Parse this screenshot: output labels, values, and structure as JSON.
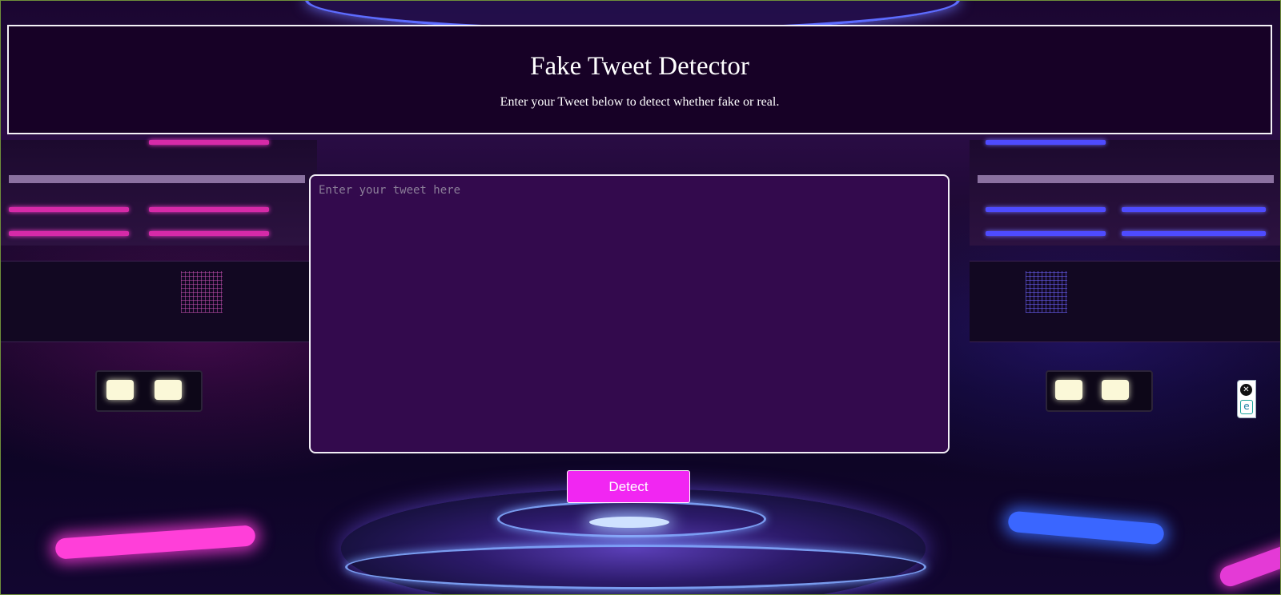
{
  "header": {
    "title": "Fake Tweet Detector",
    "subtitle": "Enter your Tweet below to detect whether fake or real."
  },
  "form": {
    "tweet_value": "",
    "tweet_placeholder": "Enter your tweet here",
    "detect_label": "Detect"
  },
  "extension_widget": {
    "close_icon": "close-icon",
    "logo_icon": "extension-logo-icon",
    "close_glyph": "✕",
    "logo_glyph": "e"
  },
  "colors": {
    "header_bg": "#170126",
    "textarea_bg": "#330a4d",
    "button_bg": "#f126f2",
    "border": "#f4f1f7"
  }
}
